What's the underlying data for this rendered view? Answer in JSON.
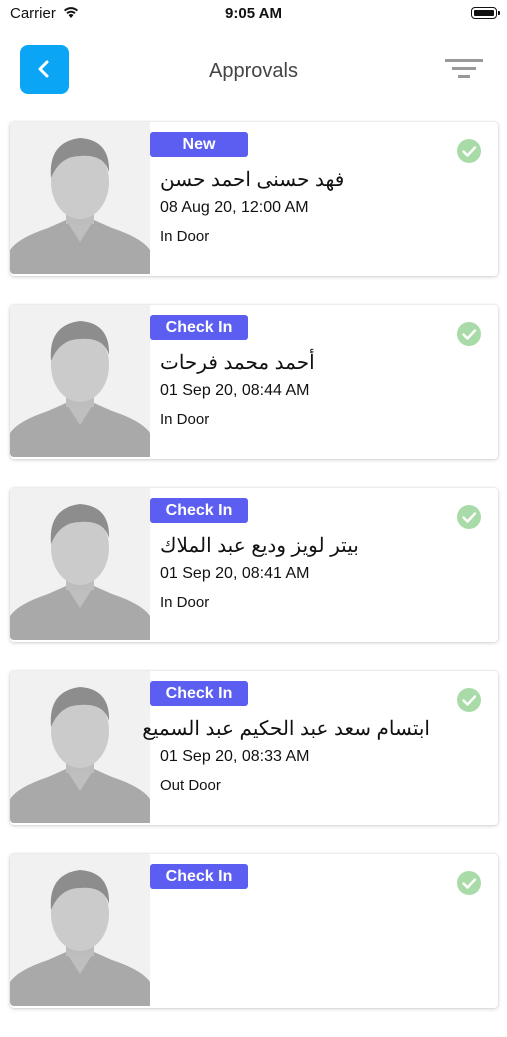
{
  "status_bar": {
    "carrier": "Carrier",
    "time": "9:05 AM"
  },
  "nav": {
    "title": "Approvals"
  },
  "colors": {
    "accent": "#0aa6f5",
    "badge": "#5b5ef0",
    "check": "#a9dba9"
  },
  "approvals": [
    {
      "badge": "New",
      "name": "فهد حسنى احمد حسن",
      "datetime": "08 Aug 20, 12:00 AM",
      "door": "In Door"
    },
    {
      "badge": "Check In",
      "name": "أحمد محمد فرحات",
      "datetime": "01 Sep 20, 08:44 AM",
      "door": "In Door"
    },
    {
      "badge": "Check In",
      "name": "بيتر لويز وديع عبد الملاك",
      "datetime": "01 Sep 20, 08:41 AM",
      "door": "In Door"
    },
    {
      "badge": "Check In",
      "name": "ابتسام سعد عبد الحكيم عبد السميع",
      "datetime": "01 Sep 20, 08:33 AM",
      "door": "Out Door"
    },
    {
      "badge": "Check In",
      "name": "",
      "datetime": "",
      "door": ""
    }
  ]
}
